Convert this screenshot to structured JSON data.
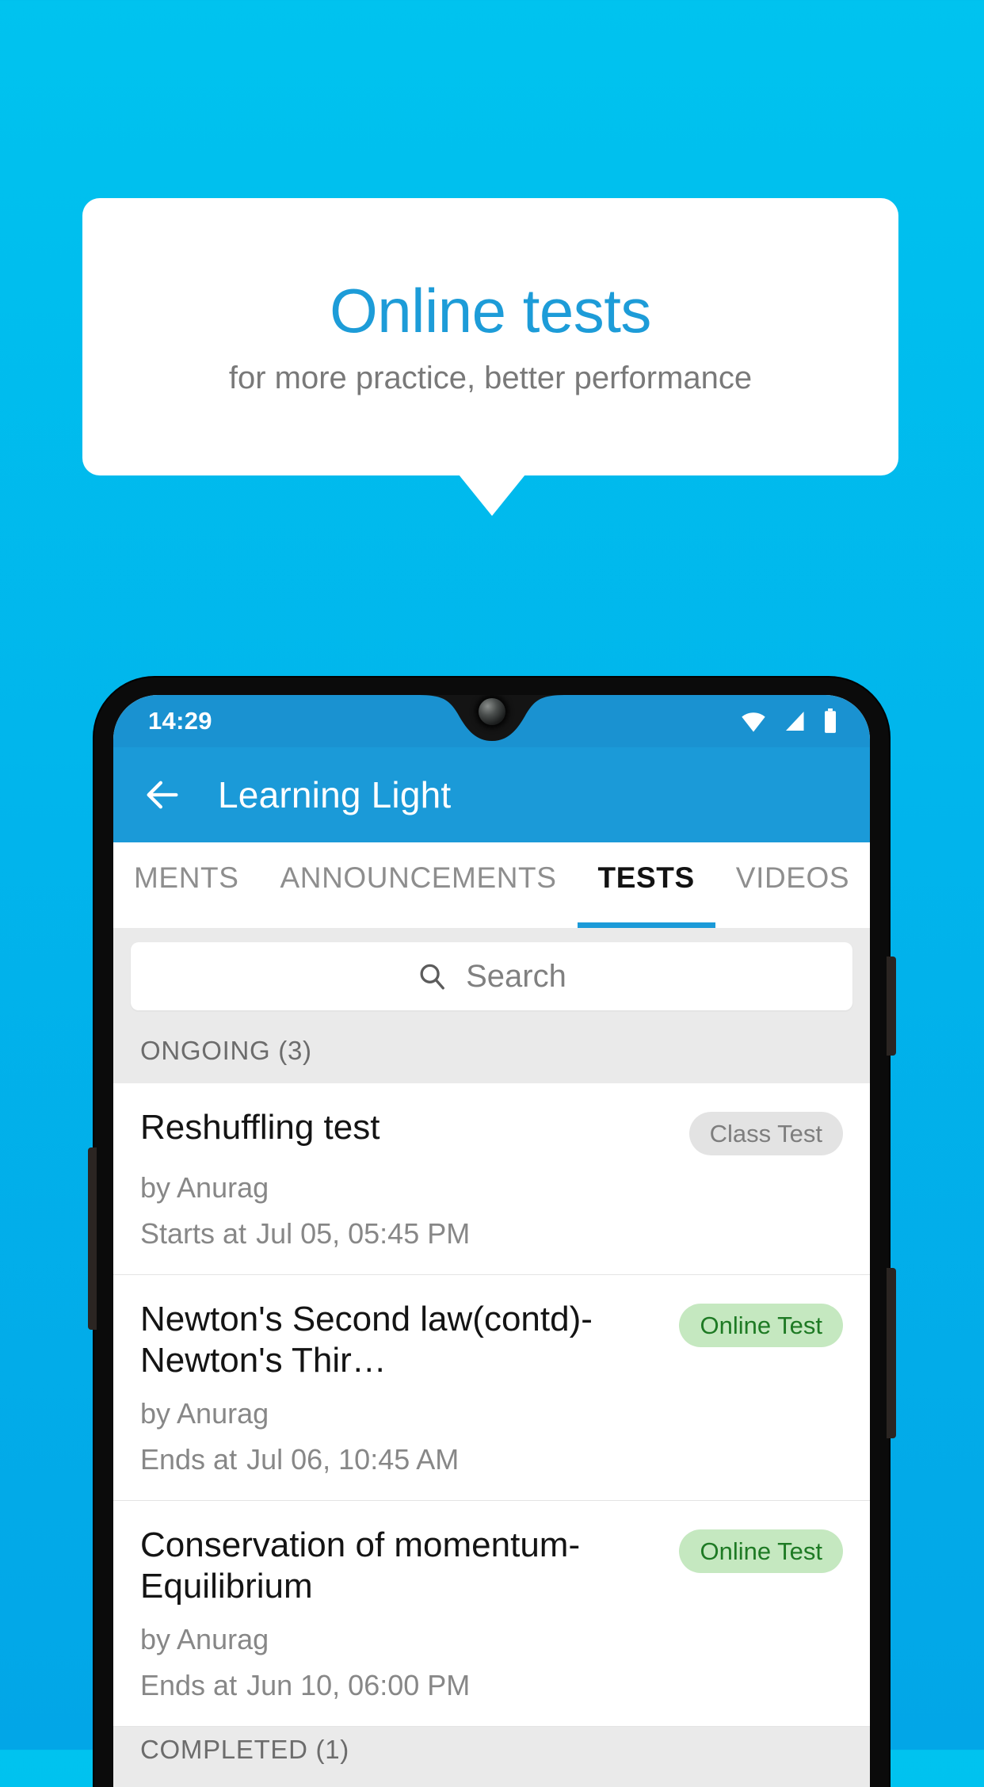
{
  "promo": {
    "title": "Online tests",
    "subtitle": "for more practice, better performance",
    "title_color": "#1d9cd8",
    "subtitle_color": "#797979",
    "card_bg": "#ffffff"
  },
  "background": {
    "gradient_top": "#00c3ef",
    "gradient_bottom": "#02a6e7"
  },
  "phone": {
    "status_bar": {
      "time": "14:29",
      "bg_color": "#1a92d1",
      "icons": [
        "wifi-icon",
        "signal-icon",
        "battery-icon"
      ]
    },
    "app_bar": {
      "back_icon": "back-arrow-icon",
      "title": "Learning Light",
      "bg_color": "#1b9ad8"
    },
    "tabs": [
      {
        "label": "MENTS",
        "active": false
      },
      {
        "label": "ANNOUNCEMENTS",
        "active": false
      },
      {
        "label": "TESTS",
        "active": true
      },
      {
        "label": "VIDEOS",
        "active": false
      }
    ],
    "tab_indicator_color": "#1b9ad8",
    "search": {
      "icon": "search-icon",
      "placeholder": "Search",
      "value": ""
    },
    "sections": [
      {
        "header": "ONGOING (3)",
        "items": [
          {
            "title": "Reshuffling test",
            "badge": "Class Test",
            "badge_style": "gray",
            "author": "by Anurag",
            "time_label": "Starts at",
            "time_value": "Jul 05, 05:45 PM"
          },
          {
            "title": "Newton's Second law(contd)-Newton's Thir…",
            "badge": "Online Test",
            "badge_style": "green",
            "author": "by Anurag",
            "time_label": "Ends at",
            "time_value": "Jul 06, 10:45 AM"
          },
          {
            "title": "Conservation of momentum-Equilibrium",
            "badge": "Online Test",
            "badge_style": "green",
            "author": "by Anurag",
            "time_label": "Ends at",
            "time_value": "Jun 10, 06:00 PM"
          }
        ]
      },
      {
        "header": "COMPLETED (1)",
        "items": []
      }
    ],
    "badge_colors": {
      "gray_bg": "#e3e3e3",
      "gray_text": "#7e7e7e",
      "green_bg": "#c5e8c0",
      "green_text": "#1e7a24"
    }
  }
}
